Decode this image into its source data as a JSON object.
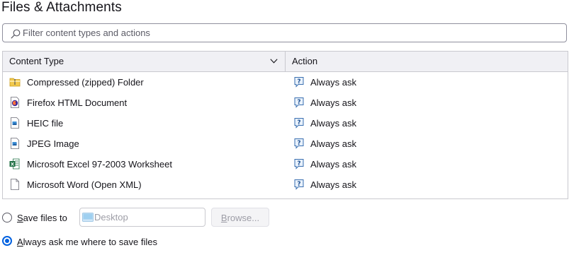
{
  "page": {
    "title": "Files & Attachments"
  },
  "search": {
    "placeholder": "Filter content types and actions",
    "value": ""
  },
  "table": {
    "columns": {
      "content_type": "Content Type",
      "action": "Action"
    },
    "rows": [
      {
        "type": "Compressed (zipped) Folder",
        "icon": "zip-folder-icon",
        "action": "Always ask"
      },
      {
        "type": "Firefox HTML Document",
        "icon": "firefox-html-icon",
        "action": "Always ask"
      },
      {
        "type": "HEIC file",
        "icon": "image-file-icon",
        "action": "Always ask"
      },
      {
        "type": "JPEG Image",
        "icon": "image-file-icon",
        "action": "Always ask"
      },
      {
        "type": "Microsoft Excel 97-2003 Worksheet",
        "icon": "excel-file-icon",
        "action": "Always ask"
      },
      {
        "type": "Microsoft Word (Open XML)",
        "icon": "blank-file-icon",
        "action": "Always ask"
      }
    ],
    "action_icon": "ask-question-icon"
  },
  "download_options": {
    "save_files_to": {
      "label_prefix": "",
      "label_access": "S",
      "label_rest": "ave files to",
      "selected": false
    },
    "folder": {
      "value": "Desktop",
      "icon": "desktop-folder-icon"
    },
    "browse": {
      "label_access": "B",
      "label_rest": "rowse...",
      "enabled": false
    },
    "always_ask": {
      "label_access": "A",
      "label_rest": "lways ask me where to save files",
      "selected": true
    }
  },
  "colors": {
    "accent": "#0061e0",
    "border": "#c9c9cf",
    "header_bg": "#f0f0f4",
    "text": "#15141a"
  }
}
